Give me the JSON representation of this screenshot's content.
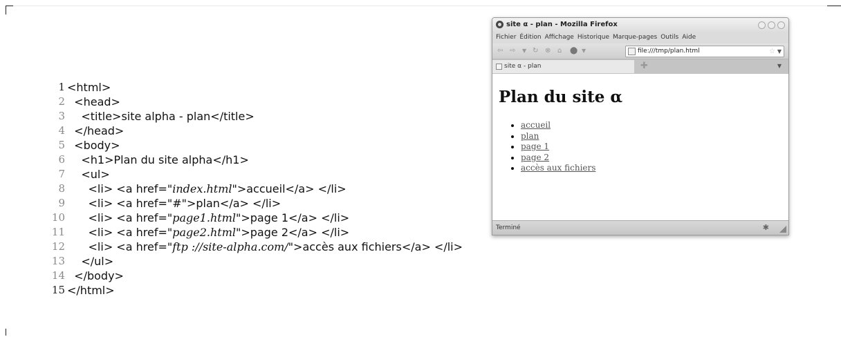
{
  "code": {
    "lines": [
      {
        "n": "1",
        "parts": [
          {
            "t": "<html>"
          }
        ]
      },
      {
        "n": "2",
        "parts": [
          {
            "t": "  <head>"
          }
        ]
      },
      {
        "n": "3",
        "parts": [
          {
            "t": "    <title>site alpha - plan</title>"
          }
        ]
      },
      {
        "n": "4",
        "parts": [
          {
            "t": "  </head>"
          }
        ]
      },
      {
        "n": "5",
        "parts": [
          {
            "t": "  <body>"
          }
        ]
      },
      {
        "n": "6",
        "parts": [
          {
            "t": "    <h1>Plan du site alpha</h1>"
          }
        ]
      },
      {
        "n": "7",
        "parts": [
          {
            "t": "    <ul>"
          }
        ]
      },
      {
        "n": "8",
        "parts": [
          {
            "t": "      <li> <a href=\""
          },
          {
            "t": "index.html",
            "i": true
          },
          {
            "t": "\">accueil</a> </li>"
          }
        ]
      },
      {
        "n": "9",
        "parts": [
          {
            "t": "      <li> <a href=\"#\">plan</a> </li>"
          }
        ]
      },
      {
        "n": "10",
        "parts": [
          {
            "t": "      <li> <a href=\""
          },
          {
            "t": "page1.html",
            "i": true
          },
          {
            "t": "\">page 1</a> </li>"
          }
        ]
      },
      {
        "n": "11",
        "parts": [
          {
            "t": "      <li> <a href=\""
          },
          {
            "t": "page2.html",
            "i": true
          },
          {
            "t": "\">page 2</a> </li>"
          }
        ]
      },
      {
        "n": "12",
        "parts": [
          {
            "t": "      <li> <a href=\""
          },
          {
            "t": "ftp ://site-alpha.com/",
            "i": true
          },
          {
            "t": "\">accès aux fichiers</a> </li>"
          }
        ]
      },
      {
        "n": "13",
        "parts": [
          {
            "t": "    </ul>"
          }
        ]
      },
      {
        "n": "14",
        "parts": [
          {
            "t": "  </body>"
          }
        ]
      },
      {
        "n": "15",
        "parts": [
          {
            "t": "</html>"
          }
        ]
      }
    ]
  },
  "browser": {
    "window_title": "site α - plan - Mozilla Firefox",
    "menu": [
      "Fichier",
      "Édition",
      "Affichage",
      "Historique",
      "Marque-pages",
      "Outils",
      "Aide"
    ],
    "url": "file:///tmp/plan.html",
    "tab_label": "site α - plan",
    "new_tab_glyph": "✚",
    "status": "Terminé",
    "page": {
      "heading": "Plan du site α",
      "links": [
        "accueil",
        "plan",
        "page 1",
        "page 2",
        "accès aux fichiers"
      ]
    }
  }
}
